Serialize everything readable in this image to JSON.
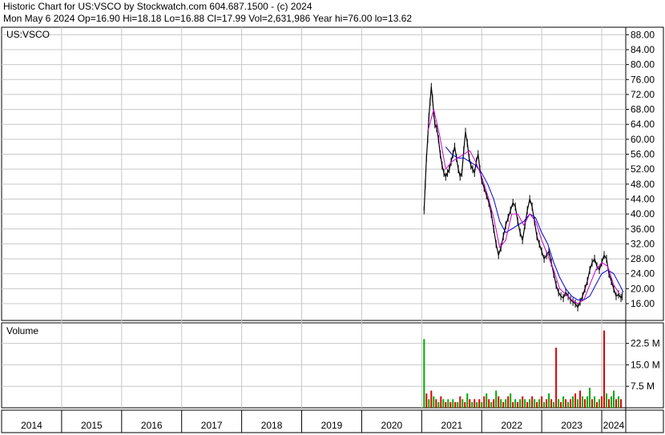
{
  "header": {
    "line1": "Historic Chart for US:VSCO by Stockwatch.com 604.687.1500 - (c) 2024",
    "line2": "Mon May  6 2024   Op=16.90   Hi=18.18   Lo=16.88   Cl=17.99   Vol=2,631,986   Year hi=76.00   lo=13.62"
  },
  "colors": {
    "background": "#ffffff",
    "grid": "#c8c8c8",
    "price_bars": "#000000",
    "ma_short": "#cc00cc",
    "ma_long": "#0000cc",
    "volume_up": "#00aa00",
    "volume_down": "#dd0000"
  },
  "chart_data": [
    {
      "type": "line",
      "title": "US:VSCO",
      "price_ticks": [
        "88.00",
        "84.00",
        "80.00",
        "76.00",
        "72.00",
        "68.00",
        "64.00",
        "60.00",
        "56.00",
        "52.00",
        "48.00",
        "44.00",
        "40.00",
        "36.00",
        "32.00",
        "28.00",
        "24.00",
        "20.00",
        "16.00"
      ],
      "year_labels": [
        "2014",
        "2015",
        "2016",
        "2017",
        "2018",
        "2019",
        "2020",
        "2021",
        "2022",
        "2023",
        "2024"
      ],
      "xlim": [
        2014.0,
        2024.4
      ],
      "ylim": [
        11.5,
        90.0
      ],
      "grid": true,
      "series": [
        {
          "kind": "price",
          "x": [
            2021.04,
            2021.06,
            2021.08,
            2021.1,
            2021.12,
            2021.14,
            2021.16,
            2021.18,
            2021.2,
            2021.22,
            2021.25,
            2021.28,
            2021.31,
            2021.34,
            2021.37,
            2021.4,
            2021.43,
            2021.46,
            2021.49,
            2021.52,
            2021.55,
            2021.58,
            2021.61,
            2021.64,
            2021.67,
            2021.7,
            2021.73,
            2021.76,
            2021.79,
            2021.82,
            2021.85,
            2021.88,
            2021.91,
            2021.94,
            2021.97,
            2022.0,
            2022.04,
            2022.08,
            2022.12,
            2022.16,
            2022.2,
            2022.24,
            2022.28,
            2022.32,
            2022.36,
            2022.4,
            2022.44,
            2022.48,
            2022.52,
            2022.56,
            2022.6,
            2022.64,
            2022.68,
            2022.72,
            2022.76,
            2022.8,
            2022.84,
            2022.88,
            2022.92,
            2022.96,
            2023.0,
            2023.04,
            2023.08,
            2023.12,
            2023.16,
            2023.2,
            2023.24,
            2023.28,
            2023.32,
            2023.36,
            2023.4,
            2023.44,
            2023.48,
            2023.52,
            2023.56,
            2023.6,
            2023.64,
            2023.68,
            2023.72,
            2023.76,
            2023.8,
            2023.84,
            2023.88,
            2023.92,
            2023.96,
            2024.0,
            2024.04,
            2024.08,
            2024.12,
            2024.16,
            2024.2,
            2024.24,
            2024.28,
            2024.32,
            2024.34
          ],
          "y": [
            41,
            48,
            55,
            60,
            66,
            70,
            74,
            71,
            67,
            64,
            63,
            60,
            56,
            53,
            51,
            50,
            51,
            52,
            54,
            56,
            58,
            55,
            52,
            50,
            51,
            57,
            62,
            59,
            55,
            53,
            52,
            51,
            54,
            56,
            52,
            49,
            47,
            45,
            43,
            40,
            36,
            32,
            29,
            31,
            34,
            37,
            39,
            41,
            43,
            42,
            38,
            35,
            33,
            37,
            41,
            44,
            42,
            38,
            34,
            32,
            30,
            28,
            29,
            30,
            27,
            24,
            21,
            19,
            18,
            17.5,
            19,
            18,
            17,
            16.5,
            16,
            15,
            16.5,
            18,
            20,
            22,
            25,
            27,
            28,
            26,
            25,
            27,
            29,
            28,
            24,
            22,
            20,
            18,
            18.5,
            17.5,
            18
          ]
        },
        {
          "kind": "ma_short",
          "x": [
            2021.1,
            2021.2,
            2021.3,
            2021.4,
            2021.5,
            2021.6,
            2021.7,
            2021.8,
            2021.9,
            2022.0,
            2022.1,
            2022.2,
            2022.3,
            2022.4,
            2022.5,
            2022.6,
            2022.7,
            2022.8,
            2022.9,
            2023.0,
            2023.1,
            2023.2,
            2023.3,
            2023.4,
            2023.5,
            2023.6,
            2023.7,
            2023.8,
            2023.9,
            2024.0,
            2024.1,
            2024.2,
            2024.3
          ],
          "y": [
            62,
            68,
            61,
            52,
            54,
            55,
            56,
            57,
            54,
            50,
            45,
            39,
            31,
            33,
            40,
            40,
            37,
            40,
            38,
            33,
            29,
            25,
            20,
            18.5,
            17,
            16,
            17,
            21,
            25,
            27,
            26,
            21,
            18.5
          ]
        },
        {
          "kind": "ma_long",
          "x": [
            2021.4,
            2021.5,
            2021.6,
            2021.7,
            2021.8,
            2021.9,
            2022.0,
            2022.1,
            2022.2,
            2022.3,
            2022.4,
            2022.5,
            2022.6,
            2022.7,
            2022.8,
            2022.9,
            2023.0,
            2023.1,
            2023.2,
            2023.3,
            2023.4,
            2023.5,
            2023.6,
            2023.7,
            2023.8,
            2023.9,
            2024.0,
            2024.1,
            2024.2,
            2024.3,
            2024.36
          ],
          "y": [
            58,
            56,
            55,
            55,
            54,
            53,
            51,
            48,
            44,
            38,
            35,
            36,
            37,
            38,
            40,
            39,
            35,
            32,
            27,
            23,
            20,
            18,
            17,
            17,
            18,
            21,
            24,
            25,
            24,
            21,
            19
          ]
        }
      ]
    },
    {
      "type": "bar",
      "title": "Volume",
      "volume_ticks": [
        "22.5 M",
        "15.0 M",
        "7.5 M"
      ],
      "xlim": [
        2014.0,
        2024.4
      ],
      "ylim": [
        0,
        28
      ],
      "grid": true,
      "series": [
        {
          "kind": "volume",
          "x": [
            2021.04,
            2021.08,
            2021.12,
            2021.16,
            2021.2,
            2021.24,
            2021.28,
            2021.32,
            2021.36,
            2021.4,
            2021.44,
            2021.48,
            2021.52,
            2021.56,
            2021.6,
            2021.64,
            2021.68,
            2021.72,
            2021.76,
            2021.8,
            2021.84,
            2021.88,
            2021.92,
            2021.96,
            2022.0,
            2022.04,
            2022.08,
            2022.12,
            2022.16,
            2022.2,
            2022.24,
            2022.28,
            2022.32,
            2022.36,
            2022.4,
            2022.44,
            2022.48,
            2022.52,
            2022.56,
            2022.6,
            2022.64,
            2022.68,
            2022.72,
            2022.76,
            2022.8,
            2022.84,
            2022.88,
            2022.92,
            2022.96,
            2023.0,
            2023.04,
            2023.08,
            2023.12,
            2023.16,
            2023.2,
            2023.24,
            2023.28,
            2023.32,
            2023.36,
            2023.4,
            2023.44,
            2023.48,
            2023.52,
            2023.56,
            2023.6,
            2023.64,
            2023.68,
            2023.72,
            2023.76,
            2023.8,
            2023.84,
            2023.88,
            2023.92,
            2023.96,
            2024.0,
            2024.04,
            2024.08,
            2024.12,
            2024.16,
            2024.2,
            2024.24,
            2024.28,
            2024.32
          ],
          "values": [
            24,
            5,
            3,
            6,
            4,
            3,
            2,
            4,
            3,
            2,
            3,
            2,
            3,
            2,
            2,
            4,
            3,
            2,
            5,
            3,
            2,
            3,
            2,
            3,
            2,
            4,
            5,
            3,
            2,
            3,
            6,
            4,
            3,
            2,
            3,
            4,
            5,
            2,
            3,
            2,
            3,
            4,
            3,
            2,
            3,
            4,
            3,
            2,
            3,
            4,
            2,
            3,
            5,
            3,
            2,
            21,
            3,
            2,
            4,
            3,
            2,
            3,
            4,
            5,
            3,
            6,
            4,
            3,
            4,
            7,
            3,
            4,
            2,
            3,
            4,
            27,
            5,
            3,
            4,
            6,
            3,
            4,
            3
          ],
          "up": [
            true,
            false,
            true,
            false,
            true,
            false,
            true,
            false,
            true,
            false,
            true,
            false,
            true,
            false,
            true,
            false,
            true,
            false,
            true,
            false,
            true,
            false,
            true,
            false,
            true,
            false,
            true,
            false,
            true,
            false,
            true,
            false,
            true,
            false,
            true,
            false,
            true,
            false,
            true,
            false,
            true,
            false,
            true,
            false,
            true,
            false,
            true,
            false,
            true,
            false,
            true,
            false,
            true,
            false,
            true,
            false,
            true,
            false,
            true,
            false,
            true,
            false,
            true,
            false,
            true,
            false,
            true,
            false,
            true,
            true,
            false,
            true,
            false,
            true,
            false,
            false,
            true,
            false,
            true,
            true,
            false,
            true,
            false
          ]
        }
      ]
    }
  ]
}
